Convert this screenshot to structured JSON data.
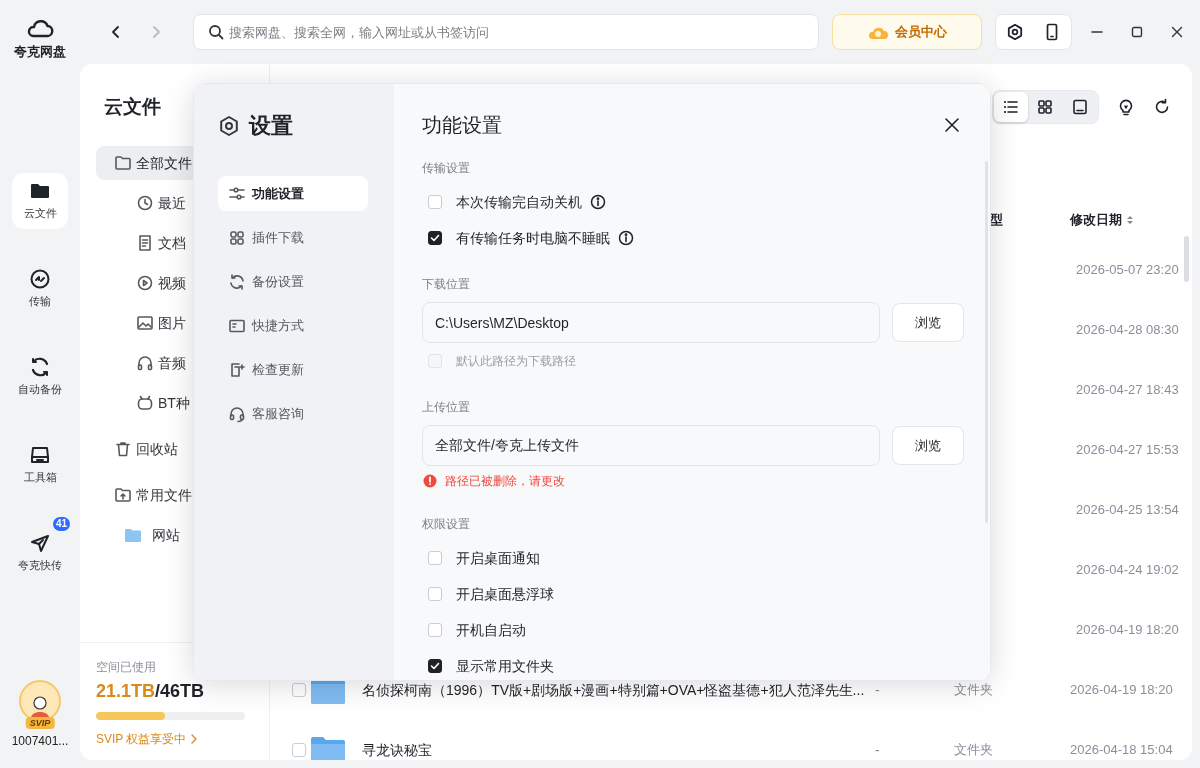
{
  "rail": {
    "logo_text": "夸克网盘",
    "items": [
      {
        "label": "云文件",
        "selected": true
      },
      {
        "label": "传输",
        "selected": false
      },
      {
        "label": "自动备份",
        "selected": false
      },
      {
        "label": "工具箱",
        "selected": false
      },
      {
        "label": "夸克快传",
        "selected": false,
        "badge": "41"
      }
    ],
    "user": {
      "badge": "SVIP",
      "name": "1007401..."
    }
  },
  "topbar": {
    "search": {
      "placeholder": "搜索网盘、搜索全网，输入网址或从书签访问"
    },
    "vip_button": "会员中心"
  },
  "sidebar": {
    "title": "云文件",
    "items": [
      {
        "label": "全部文件",
        "selected": true,
        "children": [
          {
            "label": "最近",
            "selected": false
          },
          {
            "label": "文档",
            "selected": false
          },
          {
            "label": "视频",
            "selected": false
          },
          {
            "label": "图片",
            "selected": false
          },
          {
            "label": "音频",
            "selected": false
          },
          {
            "label": "BT种",
            "selected": false
          }
        ]
      },
      {
        "label": "回收站",
        "selected": false
      },
      {
        "label": "常用文件",
        "selected": false,
        "children": [
          {
            "label": "网站",
            "selected": false
          }
        ]
      }
    ],
    "storage": {
      "label": "空间已使用",
      "used": "21.1TB",
      "total": "/46TB",
      "level": 0.46,
      "link": "SVIP 权益享受中"
    }
  },
  "file_view": {
    "view_modes": [
      {
        "selected": true
      },
      {
        "selected": false
      },
      {
        "selected": false
      }
    ],
    "columns": [
      {
        "label": "型"
      },
      {
        "label": "修改日期"
      }
    ],
    "rows": [
      {
        "modified": "2026-05-07 23:20"
      },
      {
        "modified": "2026-04-28 08:30"
      },
      {
        "modified": "2026-04-27 18:43"
      },
      {
        "modified": "2026-04-27 15:53"
      },
      {
        "modified": "2026-04-25 13:54"
      },
      {
        "modified": "2026-04-24 19:02"
      },
      {
        "modified": "2026-04-19 18:20"
      },
      {
        "checked": false,
        "name": "名侦探柯南（1996）TV版+剧场版+漫画+特别篇+OVA+怪盗基德+犯人范泽先生...",
        "size": "-",
        "type": "文件夹",
        "modified": "2026-04-19 18:20"
      },
      {
        "checked": false,
        "name": "寻龙诀秘宝",
        "size": "-",
        "type": "文件夹",
        "modified": "2026-04-18 15:04"
      }
    ]
  },
  "settings": {
    "title": "设置",
    "nav": [
      {
        "label": "功能设置",
        "selected": true
      },
      {
        "label": "插件下载",
        "selected": false
      },
      {
        "label": "备份设置",
        "selected": false
      },
      {
        "label": "快捷方式",
        "selected": false
      },
      {
        "label": "检查更新",
        "selected": false
      },
      {
        "label": "客服咨询",
        "selected": false
      }
    ],
    "panel": {
      "title": "功能设置",
      "sections": [
        {
          "label": "传输设置",
          "items": [
            {
              "kind": "checkbox",
              "label": "本次传输完自动关机",
              "checked": false,
              "disabled": false,
              "info": true
            },
            {
              "kind": "checkbox",
              "label": "有传输任务时电脑不睡眠",
              "checked": true,
              "disabled": false,
              "info": true
            }
          ]
        },
        {
          "label": "下载位置",
          "items": [
            {
              "kind": "path",
              "value": "C:\\Users\\MZ\\Desktop",
              "button": "浏览"
            },
            {
              "kind": "checkbox",
              "label": "默认此路径为下载路径",
              "checked": false,
              "disabled": true,
              "info": false
            }
          ]
        },
        {
          "label": "上传位置",
          "items": [
            {
              "kind": "path",
              "value": "全部文件/夸克上传文件",
              "button": "浏览"
            },
            {
              "kind": "error",
              "text": "路径已被删除，请更改"
            }
          ]
        },
        {
          "label": "权限设置",
          "items": [
            {
              "kind": "checkbox",
              "label": "开启桌面通知",
              "checked": false,
              "disabled": false,
              "info": false
            },
            {
              "kind": "checkbox",
              "label": "开启桌面悬浮球",
              "checked": false,
              "disabled": false,
              "info": false
            },
            {
              "kind": "checkbox",
              "label": "开机自启动",
              "checked": false,
              "disabled": false,
              "info": false
            },
            {
              "kind": "checkbox",
              "label": "显示常用文件夹",
              "checked": true,
              "disabled": false,
              "info": false
            }
          ]
        }
      ]
    }
  }
}
